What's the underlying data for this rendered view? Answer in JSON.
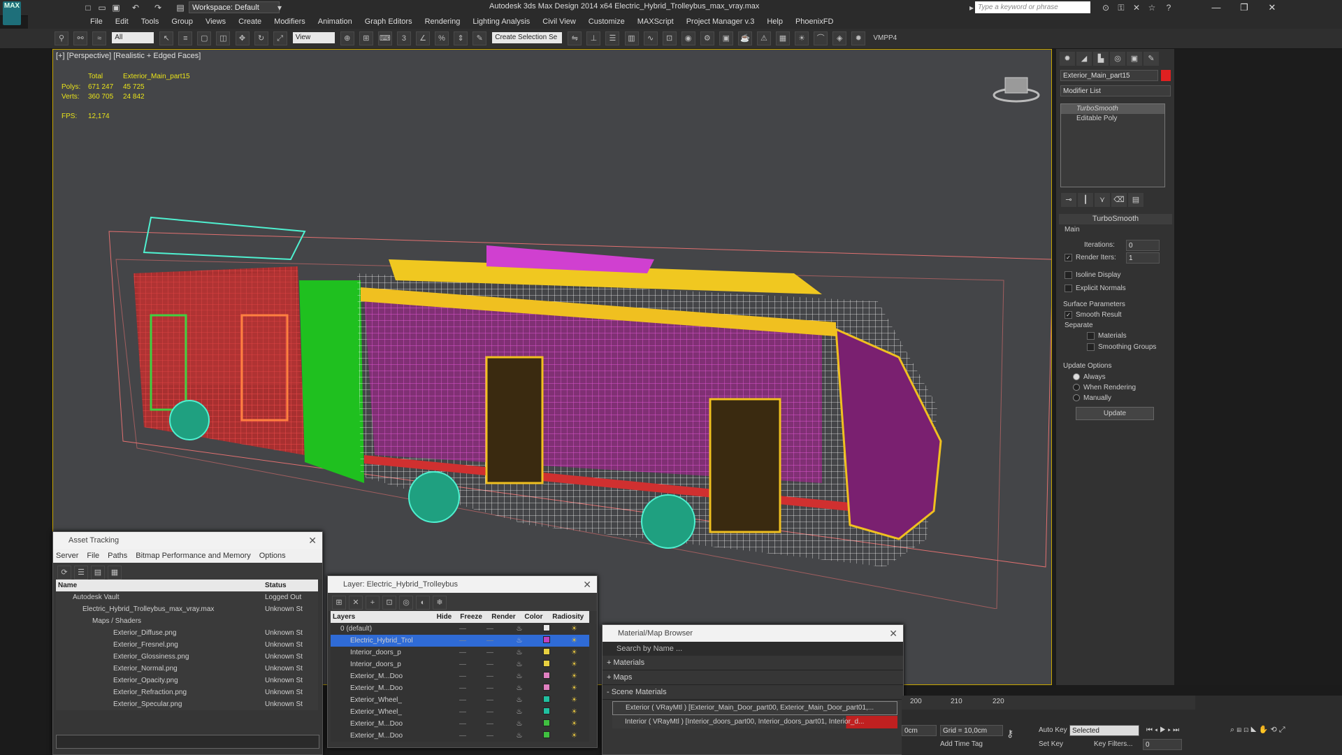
{
  "app": {
    "logo_text": "MAX",
    "title": "Autodesk 3ds Max Design 2014 x64     Electric_Hybrid_Trolleybus_max_vray.max",
    "workspace": "Workspace: Default",
    "search_placeholder": "Type a keyword or phrase"
  },
  "menu": [
    "File",
    "Edit",
    "Tools",
    "Group",
    "Views",
    "Create",
    "Modifiers",
    "Animation",
    "Graph Editors",
    "Rendering",
    "Lighting Analysis",
    "Civil View",
    "Customize",
    "MAXScript",
    "Project Manager v.3",
    "Help",
    "PhoenixFD"
  ],
  "toolbar": {
    "selection_filter": "All",
    "ref_coord": "View",
    "named_selection": "Create Selection Se",
    "vmpp_label": "VMPP4"
  },
  "viewport": {
    "label": "[+] [Perspective] [Realistic + Edged Faces]",
    "stats": {
      "col_total": "Total",
      "col_object": "Exterior_Main_part15",
      "polys_label": "Polys:",
      "polys_total": "671 247",
      "polys_object": "45 725",
      "verts_label": "Verts:",
      "verts_total": "360 705",
      "verts_object": "24 842",
      "fps_label": "FPS:",
      "fps_value": "12,174"
    }
  },
  "command_panel": {
    "object_name": "Exterior_Main_part15",
    "object_color": "#e02020",
    "modifier_list": "Modifier List",
    "stack": [
      "TurboSmooth",
      "Editable Poly"
    ],
    "rollout_title": "TurboSmooth",
    "main_label": "Main",
    "iterations_label": "Iterations:",
    "iterations_value": "0",
    "render_iters_label": "Render Iters:",
    "render_iters_value": "1",
    "isoline_display": "Isoline Display",
    "explicit_normals": "Explicit Normals",
    "surface_params": "Surface Parameters",
    "smooth_result": "Smooth Result",
    "separate": "Separate",
    "materials": "Materials",
    "smoothing_groups": "Smoothing Groups",
    "update_options": "Update Options",
    "always": "Always",
    "when_rendering": "When Rendering",
    "manually": "Manually",
    "update_button": "Update"
  },
  "asset_tracking": {
    "title": "Asset Tracking",
    "menu": [
      "Server",
      "File",
      "Paths",
      "Bitmap Performance and Memory",
      "Options"
    ],
    "columns": [
      "Name",
      "Status"
    ],
    "rows": [
      {
        "name": "Autodesk Vault",
        "status": "Logged Out",
        "indent": 0
      },
      {
        "name": "Electric_Hybrid_Trolleybus_max_vray.max",
        "status": "Unknown St",
        "indent": 1
      },
      {
        "name": "Maps / Shaders",
        "status": "",
        "indent": 2
      },
      {
        "name": "Exterior_Diffuse.png",
        "status": "Unknown St",
        "indent": 3
      },
      {
        "name": "Exterior_Fresnel.png",
        "status": "Unknown St",
        "indent": 3
      },
      {
        "name": "Exterior_Glossiness.png",
        "status": "Unknown St",
        "indent": 3
      },
      {
        "name": "Exterior_Normal.png",
        "status": "Unknown St",
        "indent": 3
      },
      {
        "name": "Exterior_Opacity.png",
        "status": "Unknown St",
        "indent": 3
      },
      {
        "name": "Exterior_Refraction.png",
        "status": "Unknown St",
        "indent": 3
      },
      {
        "name": "Exterior_Specular.png",
        "status": "Unknown St",
        "indent": 3
      }
    ]
  },
  "layer_window": {
    "title": "Layer: Electric_Hybrid_Trolleybus",
    "columns": [
      "Layers",
      "Hide",
      "Freeze",
      "Render",
      "Color",
      "Radiosity"
    ],
    "rows": [
      {
        "name": "0 (default)",
        "color": "#e8e8e8",
        "selected": false
      },
      {
        "name": "Electric_Hybrid_Trol",
        "color": "#c040c0",
        "selected": true
      },
      {
        "name": "Interior_doors_p",
        "color": "#e8d040",
        "selected": false
      },
      {
        "name": "Interior_doors_p",
        "color": "#e8d040",
        "selected": false
      },
      {
        "name": "Exterior_M...Doo",
        "color": "#e080c0",
        "selected": false
      },
      {
        "name": "Exterior_M...Doo",
        "color": "#e080c0",
        "selected": false
      },
      {
        "name": "Exterior_Wheel_",
        "color": "#20c0a0",
        "selected": false
      },
      {
        "name": "Exterior_Wheel_",
        "color": "#20c0a0",
        "selected": false
      },
      {
        "name": "Exterior_M...Doo",
        "color": "#40c040",
        "selected": false
      },
      {
        "name": "Exterior_M...Doo",
        "color": "#40c040",
        "selected": false
      }
    ]
  },
  "material_browser": {
    "title": "Material/Map Browser",
    "search_placeholder": "Search by Name ...",
    "sections": [
      "+ Materials",
      "+ Maps",
      "- Scene Materials"
    ],
    "scene_materials": [
      "Exterior ( VRayMtl ) [Exterior_Main_Door_part00, Exterior_Main_Door_part01,...",
      "Interior ( VRayMtl ) [Interior_doors_part00, Interior_doors_part01, Interior_d..."
    ]
  },
  "timeline": {
    "ticks": [
      "200",
      "210",
      "220"
    ],
    "coord_z": "0cm",
    "grid": "Grid = 10,0cm",
    "auto_key": "Auto Key",
    "set_key": "Set Key",
    "selected": "Selected",
    "add_time_tag": "Add Time Tag",
    "key_filters": "Key Filters...",
    "frame": "0"
  }
}
